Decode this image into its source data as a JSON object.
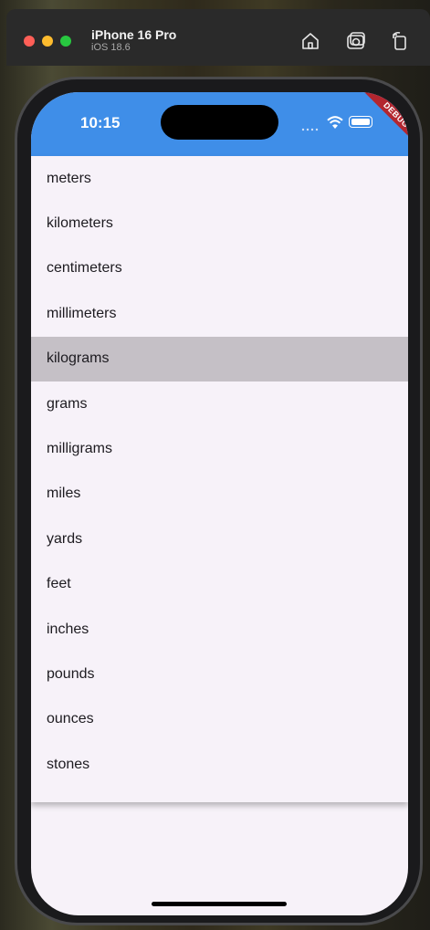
{
  "simulator": {
    "device_name": "iPhone 16 Pro",
    "os_version": "iOS 18.6"
  },
  "status_bar": {
    "time": "10:15",
    "debug_label": "DEBUG"
  },
  "menu": {
    "items": [
      {
        "label": "meters",
        "selected": false
      },
      {
        "label": "kilometers",
        "selected": false
      },
      {
        "label": "centimeters",
        "selected": false
      },
      {
        "label": "millimeters",
        "selected": false
      },
      {
        "label": "kilograms",
        "selected": true
      },
      {
        "label": "grams",
        "selected": false
      },
      {
        "label": "milligrams",
        "selected": false
      },
      {
        "label": "miles",
        "selected": false
      },
      {
        "label": "yards",
        "selected": false
      },
      {
        "label": "feet",
        "selected": false
      },
      {
        "label": "inches",
        "selected": false
      },
      {
        "label": "pounds",
        "selected": false
      },
      {
        "label": "ounces",
        "selected": false
      },
      {
        "label": "stones",
        "selected": false
      }
    ]
  },
  "colors": {
    "appbar": "#3f8ee8",
    "menu_background": "#f7f2f9",
    "selected_item": "#c5c0c6",
    "debug_banner": "#b3262f"
  },
  "icons": {
    "toolbar": [
      "home-icon",
      "screenshot-icon",
      "rotate-icon"
    ],
    "status": [
      "signal-icon",
      "wifi-icon",
      "battery-icon"
    ]
  }
}
